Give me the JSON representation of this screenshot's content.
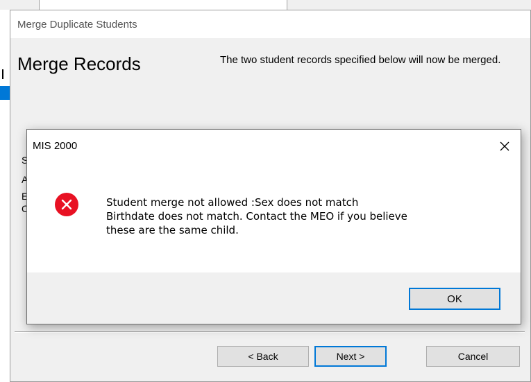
{
  "wizard": {
    "title": "Merge Duplicate Students",
    "heading": "Merge Records",
    "description": "The two student records specified below will now be merged.",
    "partial_labels": [
      "S",
      "A",
      "E",
      "C"
    ],
    "back_label": "< Back",
    "next_label": "Next >",
    "cancel_label": "Cancel"
  },
  "dialog": {
    "title": "MIS 2000",
    "close_glyph": "✕",
    "icon": "error-icon",
    "message_line1": "Student merge not allowed :Sex does not match",
    "message_line2": "Birthdate does not match. Contact the MEO if you believe",
    "message_line3": "these are the same child.",
    "ok_label": "OK"
  },
  "colors": {
    "accent": "#0078d7",
    "error": "#e81123"
  }
}
